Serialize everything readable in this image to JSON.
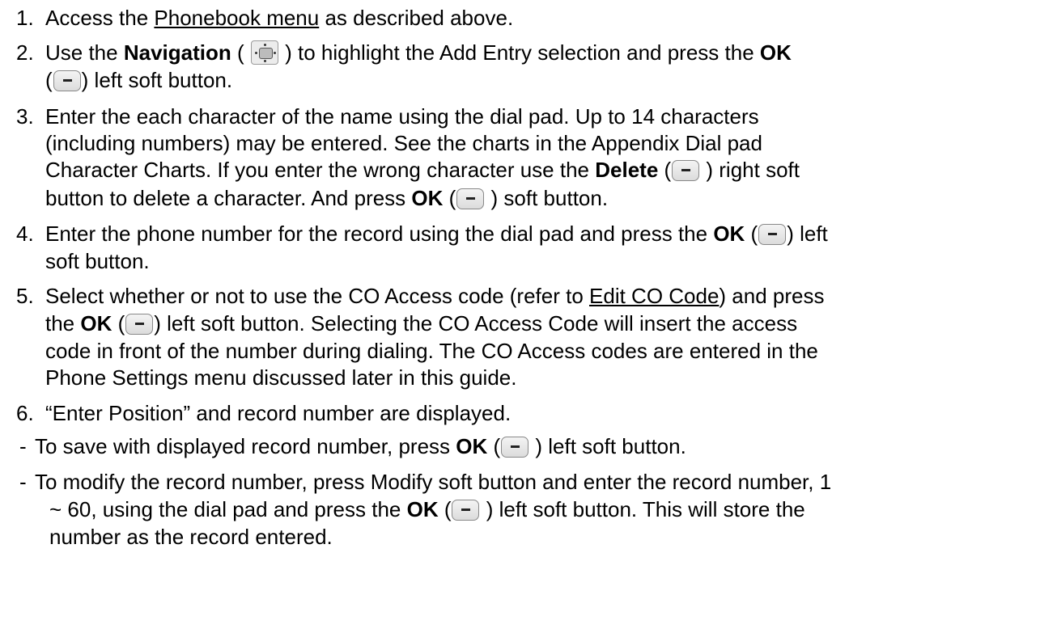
{
  "items": [
    {
      "number": "1.",
      "t1": "Access the ",
      "link": "Phonebook menu",
      "t2": " as described above."
    },
    {
      "number": "2.",
      "t1": "Use the ",
      "nav_bold": "Navigation",
      "t2": " ( ",
      "t3": " ) to highlight the Add Entry selection and press the ",
      "ok_bold": "OK",
      "t4": "(",
      "t5": ") left soft button."
    },
    {
      "number": "3.",
      "l1": "Enter the each character of the name using the dial pad.  Up to 14 characters",
      "l2": "(including numbers) may be entered.  See the charts in the Appendix Dial pad",
      "l3a": "Character Charts.  If you enter the wrong character use the ",
      "delete_bold": "Delete",
      "l3b": " (",
      "l3c": " ) right soft",
      "l4a": "button to delete a character. And press ",
      "ok_bold": "OK",
      "l4b": " (",
      "l4c": " ) soft button."
    },
    {
      "number": "4.",
      "l1a": "Enter the phone number for the record using the dial pad and press the ",
      "ok_bold": "OK",
      "l1b": " (",
      "l1c": ") left",
      "l2": "soft button."
    },
    {
      "number": "5.",
      "l1a": "Select whether or not to use the CO Access code (refer to ",
      "link": "Edit CO Code",
      "l1b": ") and press",
      "l2a": "the ",
      "ok_bold": "OK",
      "l2b": " (",
      "l2c": ") left soft button.  Selecting the CO Access Code will insert the access",
      "l3": "code in front of the number during dialing.  The CO Access codes are entered in the",
      "l4": "Phone Settings menu discussed later in this guide."
    },
    {
      "number": "6.",
      "text": "“Enter Position” and record number are displayed."
    }
  ],
  "sub_items": [
    {
      "bullet": "-",
      "t1": "To save with displayed record number, press ",
      "ok_bold": "OK",
      "t2": " (",
      "t3": " ) left soft button."
    },
    {
      "bullet": "-",
      "l1": "To modify the record number, press Modify soft button and enter the record number, 1",
      "l2a": "~ 60, using the dial pad and press the ",
      "ok_bold": "OK",
      "l2b": " (",
      "l2c": " ) left soft button.  This will store the",
      "l3": "number as the record entered."
    }
  ],
  "icons": {
    "soft_button": "soft-button-icon",
    "navigation": "navigation-key-icon"
  }
}
